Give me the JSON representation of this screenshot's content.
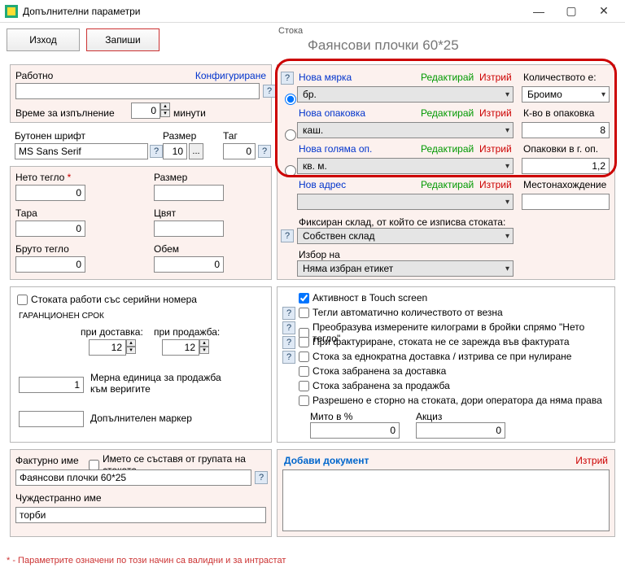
{
  "window": {
    "title": "Допълнителни параметри"
  },
  "toolbar": {
    "exit": "Изход",
    "save": "Запиши"
  },
  "stock": {
    "label": "Стока",
    "value": "Фаянсови плочки 60*25"
  },
  "left": {
    "working": "Работно",
    "configure": "Конфигуриране",
    "exec_time": "Време за изпълнение",
    "exec_val": "0",
    "minutes": "минути",
    "btnfont": "Бутонен шрифт",
    "font_val": "MS Sans Serif",
    "size": "Размер",
    "size_val": "10",
    "tag": "Таг",
    "tag_val": "0",
    "net": "Нето тегло",
    "net_val": "0",
    "size2": "Размер",
    "tara": "Тара",
    "tara_val": "0",
    "color": "Цвят",
    "gross": "Бруто тегло",
    "gross_val": "0",
    "volume": "Обем",
    "volume_val": "0",
    "serial": "Стоката работи със серийни номера",
    "warranty": "ГАРАНЦИОНЕН СРОК",
    "on_delivery": "при доставка:",
    "on_sale": "при продажба:",
    "wd_val": "12",
    "ws_val": "12",
    "unit_chain": "Мерна единица за продажба към веригите",
    "unit_val": "1",
    "extra_marker": "Допълнителен маркер",
    "inv_name": "Фактурно име",
    "name_from_group": "Името се съставя от групата на стоката",
    "inv_val": "Фаянсови плочки 60*25",
    "foreign": "Чуждестранно име",
    "foreign_val": "торби"
  },
  "right": {
    "new_measure": "Нова мярка",
    "edit": "Редактирай",
    "delete": "Изтрий",
    "qty_is": "Количеството е:",
    "br": "бр.",
    "countable": "Броимо",
    "new_pack": "Нова опаковка",
    "qty_in_pack": "К-во в опаковка",
    "kash": "каш.",
    "qip_val": "8",
    "new_big": "Нова голяма оп.",
    "pack_in_big": "Опаковки в г. оп.",
    "kvm": "кв. м.",
    "pib_val": "1,2",
    "new_addr": "Нов адрес",
    "location": "Местонахождение",
    "fixed_wh": "Фиксиран склад, от който се изписва стоката:",
    "own_wh": "Собствен склад",
    "label_sel": "Избор на",
    "no_label": "Няма избран етикет",
    "touch": "Активност в Touch screen",
    "weigh": "Тегли автоматично количеството от везна",
    "convert": "Преобразува измерените килограми в бройки спрямо \"Нето тегло\"",
    "no_invoice": "При фактуриране, стоката не се зарежда във фактурата",
    "single": "Стока за еднократна доставка / изтрива се при нулиране",
    "no_deliv": "Стока забранена за доставка",
    "no_sale": "Стока забранена за продажба",
    "storno": "Разрешено е сторно на стоката, дори оператора да няма права",
    "duty_pct": "Мито в %",
    "duty_val": "0",
    "excise": "Акциз",
    "excise_val": "0",
    "add_doc": "Добави документ"
  },
  "footer": "* - Параметрите означени по този начин са валидни и за интрастат"
}
